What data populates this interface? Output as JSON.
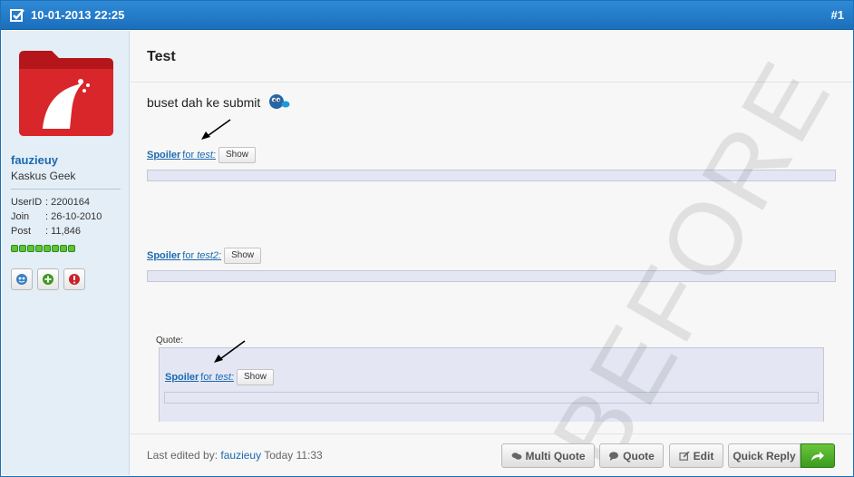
{
  "header": {
    "date": "10-01-2013 22:25",
    "post_number": "#1"
  },
  "user": {
    "username": "fauzieuy",
    "rank": "Kaskus Geek",
    "stats": [
      {
        "key": "UserID",
        "value": ": 2200164"
      },
      {
        "key": "Join",
        "value": ": 26-10-2010"
      },
      {
        "key": "Post",
        "value": ": 11,846"
      }
    ],
    "reputation_level": 8
  },
  "post": {
    "title": "Test",
    "body": "buset dah ke submit",
    "watermark": "BEFORE",
    "spoilers": [
      {
        "label": "Spoiler",
        "for_text": " for ",
        "name": "test:",
        "button": "Show"
      },
      {
        "label": "Spoiler",
        "for_text": " for ",
        "name": "test2:",
        "button": "Show"
      }
    ],
    "quote": {
      "label": "Quote:",
      "spoiler": {
        "label": "Spoiler",
        "for_text": " for ",
        "name": "test:",
        "button": "Show"
      }
    }
  },
  "footer": {
    "edited_prefix": "Last edited by:",
    "edited_user": "fauzieuy",
    "edited_time": "Today 11:33",
    "buttons": {
      "multi_quote": "Multi Quote",
      "quote": "Quote",
      "edit": "Edit",
      "quick_reply": "Quick Reply"
    }
  },
  "colors": {
    "header": "#1b6fbd",
    "link": "#1a69b0",
    "sidebar": "#e4eef6",
    "reputation": "#5ec23a",
    "quick_reply": "#3b9b1d"
  },
  "icons": [
    "checkbox-icon",
    "emoticon-icon",
    "spoiler-arrow-icon",
    "user-info-icon",
    "add-reputation-icon",
    "report-icon",
    "speech-bubbles-icon",
    "speech-bubble-icon",
    "edit-icon",
    "reply-arrow-icon"
  ]
}
